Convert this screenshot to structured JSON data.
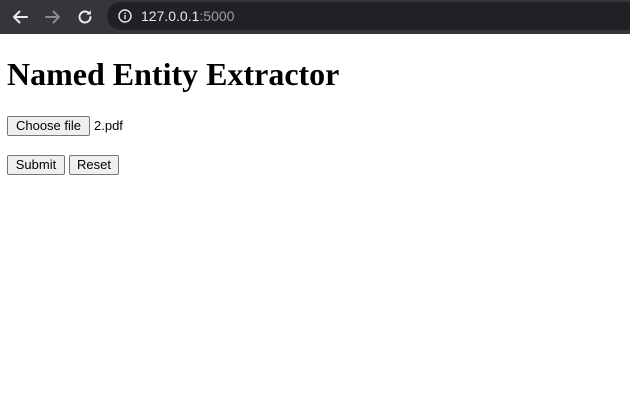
{
  "browser": {
    "url_host": "127.0.0.1",
    "url_port": ":5000",
    "icons": {
      "back": "arrow-left-icon",
      "forward": "arrow-right-icon",
      "reload": "reload-icon",
      "site_info": "info-icon"
    },
    "colors": {
      "toolbar": "#35363a",
      "omnibox": "#202124",
      "host_text": "#e8eaed",
      "port_text": "#9aa0a6"
    }
  },
  "page": {
    "title": "Named Entity Extractor",
    "file_input": {
      "button_label": "Choose file",
      "selected_file": "2.pdf"
    },
    "submit_label": "Submit",
    "reset_label": "Reset"
  }
}
